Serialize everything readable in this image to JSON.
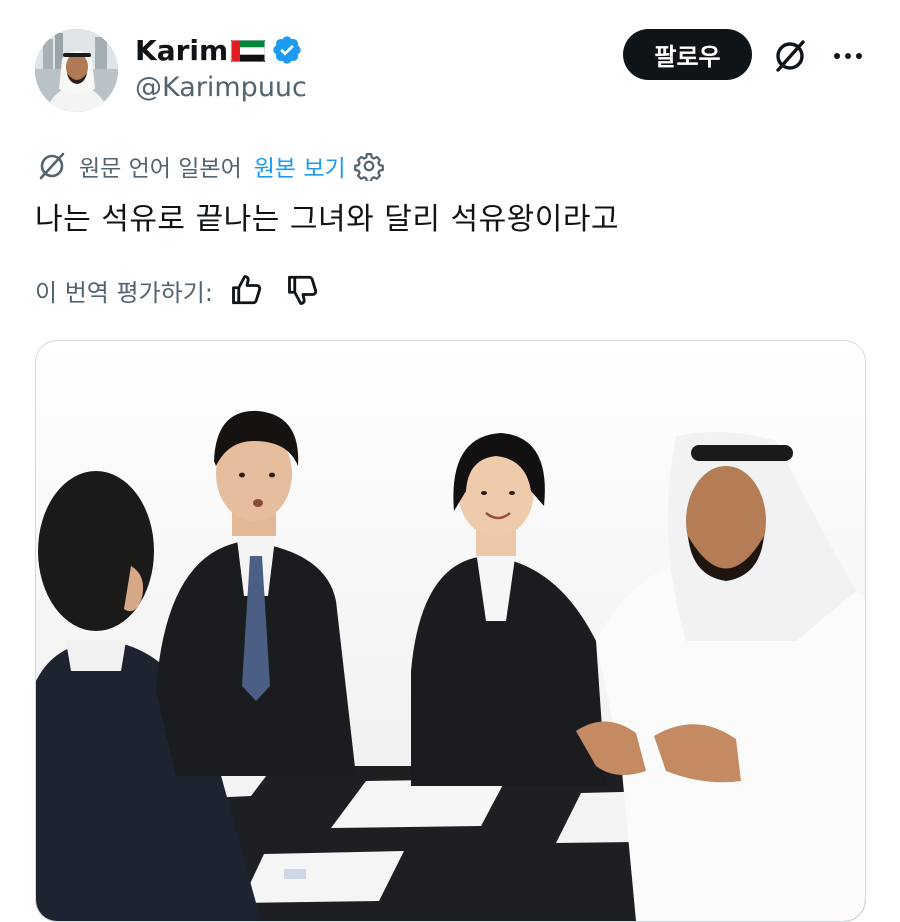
{
  "author": {
    "name": "Karim",
    "handle": "@Karimpuuc",
    "flag_icon": "uae-flag-icon",
    "verified_icon": "verified-badge-icon"
  },
  "header": {
    "follow_label": "팔로우",
    "grok_icon": "grok-icon",
    "more_icon": "more-icon"
  },
  "translation": {
    "source_text": "원문 언어 일본어",
    "show_original": "원본 보기",
    "rate_label": "이 번역 평가하기:",
    "settings_icon": "gear-icon",
    "thumbs_up_icon": "thumbs-up-icon",
    "thumbs_down_icon": "thumbs-down-icon"
  },
  "tweet": {
    "text": "나는 석유로 끝나는 그녀와 달리 석유왕이라고"
  },
  "colors": {
    "text": "#0f1419",
    "secondary": "#536471",
    "link": "#1d9bf0",
    "button_bg": "#0f1419"
  }
}
